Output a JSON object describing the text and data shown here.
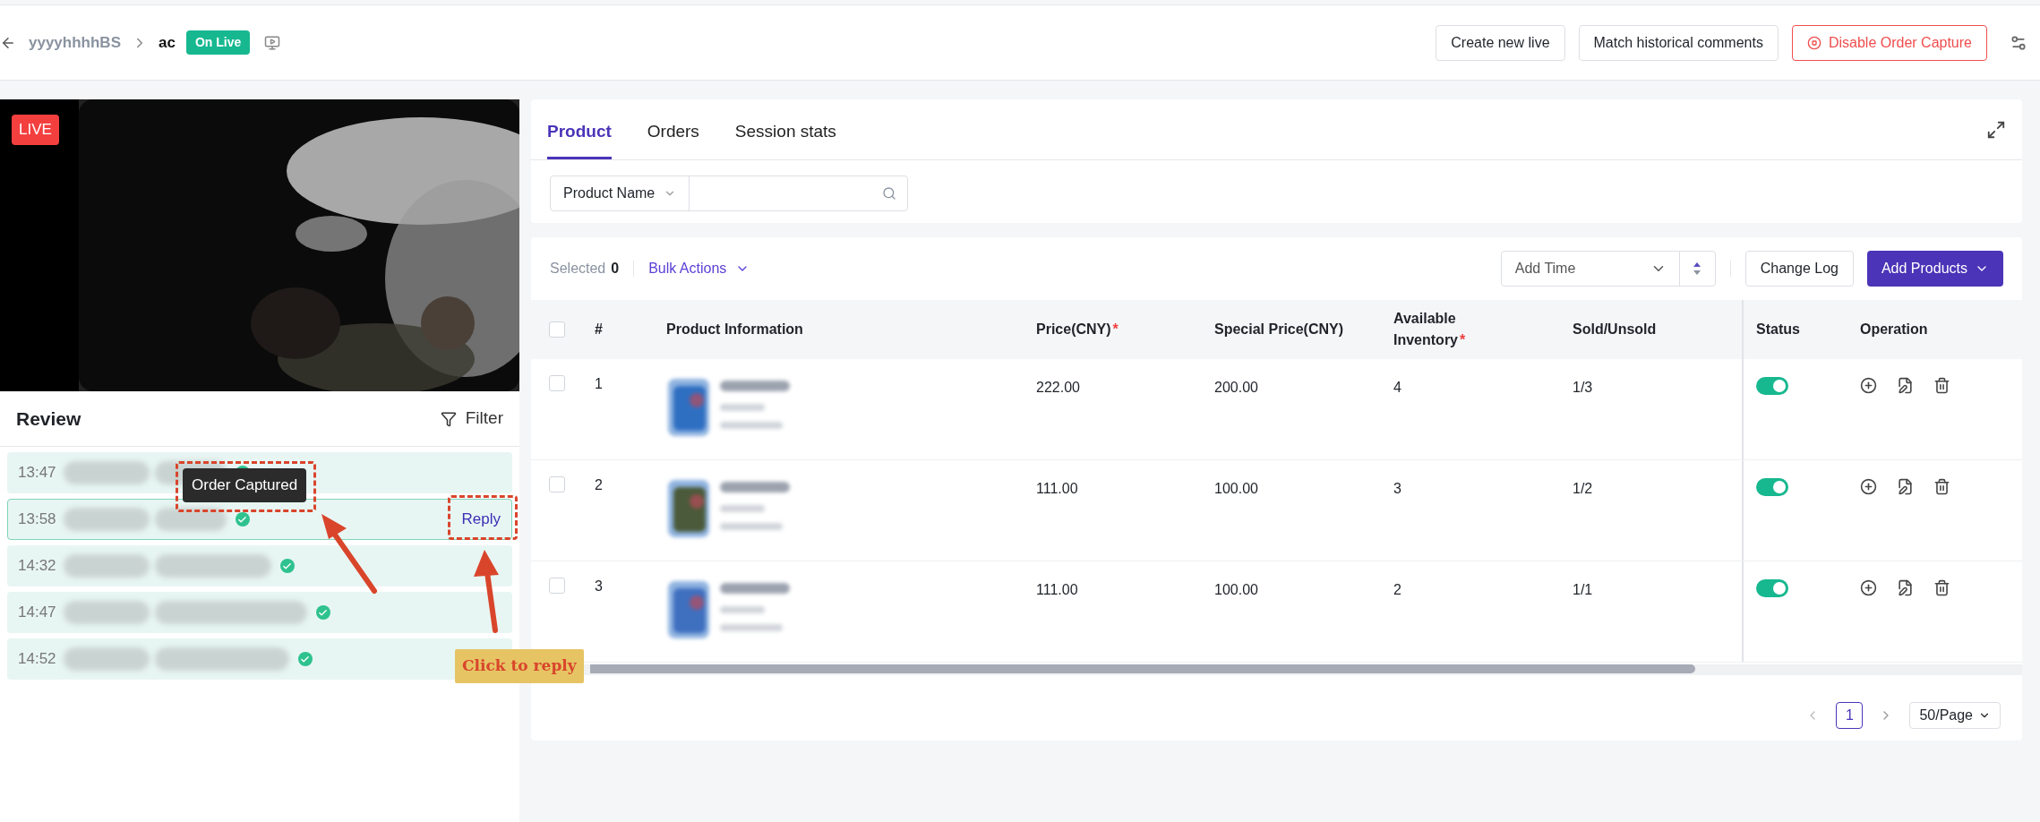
{
  "header": {
    "breadcrumbs": [
      {
        "text": "yyyyhhhhBS",
        "current": false
      },
      {
        "text": "ac",
        "current": true
      }
    ],
    "status_badge": "On Live",
    "buttons": [
      {
        "label": "Create new live",
        "kind": "plain"
      },
      {
        "label": "Match historical comments",
        "kind": "plain"
      },
      {
        "label": "Disable Order Capture",
        "kind": "danger"
      }
    ]
  },
  "video": {
    "badge": "LIVE"
  },
  "review": {
    "title": "Review",
    "filter": "Filter",
    "tooltip": "Order Captured",
    "comments": [
      {
        "time": "13:47",
        "selected": false,
        "captured": true
      },
      {
        "time": "13:58",
        "selected": true,
        "captured": true,
        "action": "Reply"
      },
      {
        "time": "14:32",
        "selected": false,
        "captured": true
      },
      {
        "time": "14:47",
        "selected": false,
        "captured": true
      },
      {
        "time": "14:52",
        "selected": false,
        "captured": true
      }
    ]
  },
  "tabs": [
    {
      "label": "Product",
      "selected": true
    },
    {
      "label": "Orders",
      "selected": false
    },
    {
      "label": "Session stats",
      "selected": false
    }
  ],
  "search": {
    "field_select": "Product Name"
  },
  "toolbar": {
    "selected_label": "Selected",
    "selected_count": "0",
    "bulk_actions": "Bulk Actions",
    "sort": "Add Time",
    "change_log": "Change Log",
    "add_products": "Add Products"
  },
  "table": {
    "header_checked": false,
    "columns": [
      {
        "label": "#"
      },
      {
        "label": "Product Information"
      },
      {
        "label": "Price(CNY)",
        "required_mark": "*"
      },
      {
        "label": "Special Price(CNY)"
      },
      {
        "label": "Available Inventory",
        "required_mark": "*"
      },
      {
        "label": "Sold/Unsold"
      },
      {
        "label": "Status"
      },
      {
        "label": "Operation"
      }
    ],
    "rows": [
      {
        "index": "1",
        "price": "222.00",
        "special_price": "200.00",
        "inventory": "4",
        "sold": "1/3",
        "checked": false,
        "status_on": true
      },
      {
        "index": "2",
        "price": "111.00",
        "special_price": "100.00",
        "inventory": "3",
        "sold": "1/2",
        "checked": false,
        "status_on": true
      },
      {
        "index": "3",
        "price": "111.00",
        "special_price": "100.00",
        "inventory": "2",
        "sold": "1/1",
        "checked": false,
        "status_on": true
      }
    ]
  },
  "pagination": {
    "page": "1",
    "page_size": "50/Page"
  },
  "annotation": {
    "callout": "Click to reply"
  }
}
